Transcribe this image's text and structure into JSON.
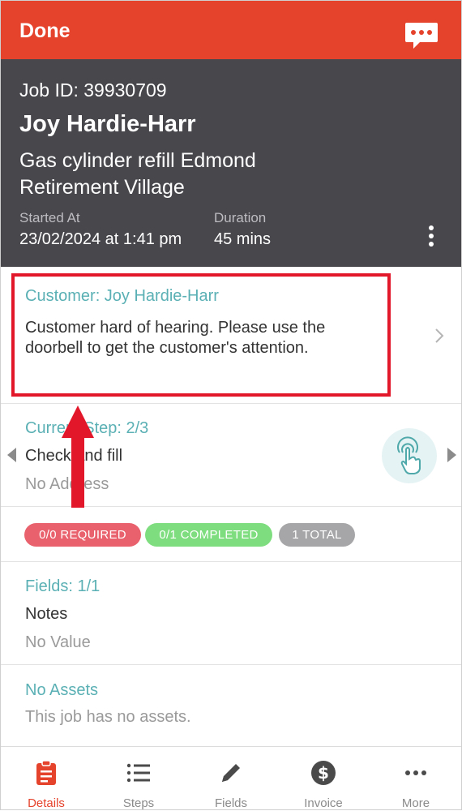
{
  "topbar": {
    "done_label": "Done",
    "chat_icon": "chat-bubble-icon"
  },
  "job": {
    "id_text": "Job ID: 39930709",
    "customer_name": "Joy Hardie-Harr",
    "title": "Gas cylinder refill Edmond Retirement Village",
    "started_label": "Started At",
    "started_value": "23/02/2024 at 1:41 pm",
    "duration_label": "Duration",
    "duration_value": "45 mins"
  },
  "customer_section": {
    "label": "Customer: Joy Hardie-Harr",
    "note": "Customer hard of hearing. Please use the doorbell to get the customer's attention."
  },
  "step_section": {
    "label": "Current Step: 2/3",
    "name": "Check and fill",
    "address": "No Address"
  },
  "badges": {
    "required": "0/0 REQUIRED",
    "completed": "0/1 COMPLETED",
    "total": "1 TOTAL"
  },
  "fields_section": {
    "label": "Fields: 1/1",
    "name": "Notes",
    "value": "No Value"
  },
  "assets_section": {
    "label": "No Assets",
    "text": "This job has no assets."
  },
  "tabs": [
    {
      "label": "Details",
      "icon": "clipboard-icon",
      "active": true
    },
    {
      "label": "Steps",
      "icon": "list-icon",
      "active": false
    },
    {
      "label": "Fields",
      "icon": "pencil-icon",
      "active": false
    },
    {
      "label": "Invoice",
      "icon": "dollar-icon",
      "active": false
    },
    {
      "label": "More",
      "icon": "more-icon",
      "active": false
    }
  ],
  "colors": {
    "brand": "#e5432c",
    "header_bg": "#48474c",
    "accent_teal": "#5ab0b4",
    "highlight": "#e3172a",
    "required": "#e8616c",
    "completed": "#7edd7e",
    "total": "#a6a6a8"
  }
}
